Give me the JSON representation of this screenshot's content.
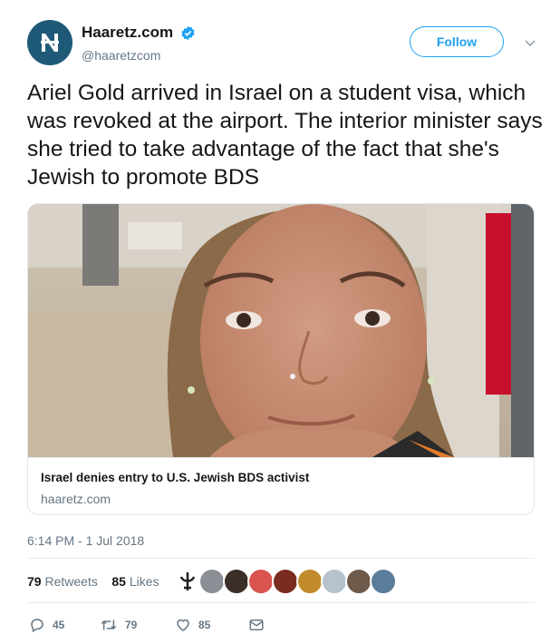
{
  "account": {
    "name": "Haaretz.com",
    "handle": "@haaretzcom",
    "verified_icon": "verified-badge-icon",
    "brand_color": "#1e5a78"
  },
  "follow_button": {
    "label": "Follow"
  },
  "tweet": {
    "text": "Ariel Gold arrived in Israel on a student visa, which was revoked at the airport. The interior minister says she tried to take advantage of the fact that she's Jewish to promote BDS",
    "timestamp": "6:14 PM - 1 Jul 2018"
  },
  "card": {
    "title": "Israel denies entry to U.S. Jewish BDS activist",
    "domain": "haaretz.com"
  },
  "stats": {
    "retweets_count": "79",
    "retweets_label": "Retweets",
    "likes_count": "85",
    "likes_label": "Likes"
  },
  "actions": {
    "replies": "45",
    "retweets": "79",
    "likes": "85"
  },
  "colors": {
    "accent": "#1da1f2",
    "muted": "#657786",
    "text": "#14171a"
  }
}
